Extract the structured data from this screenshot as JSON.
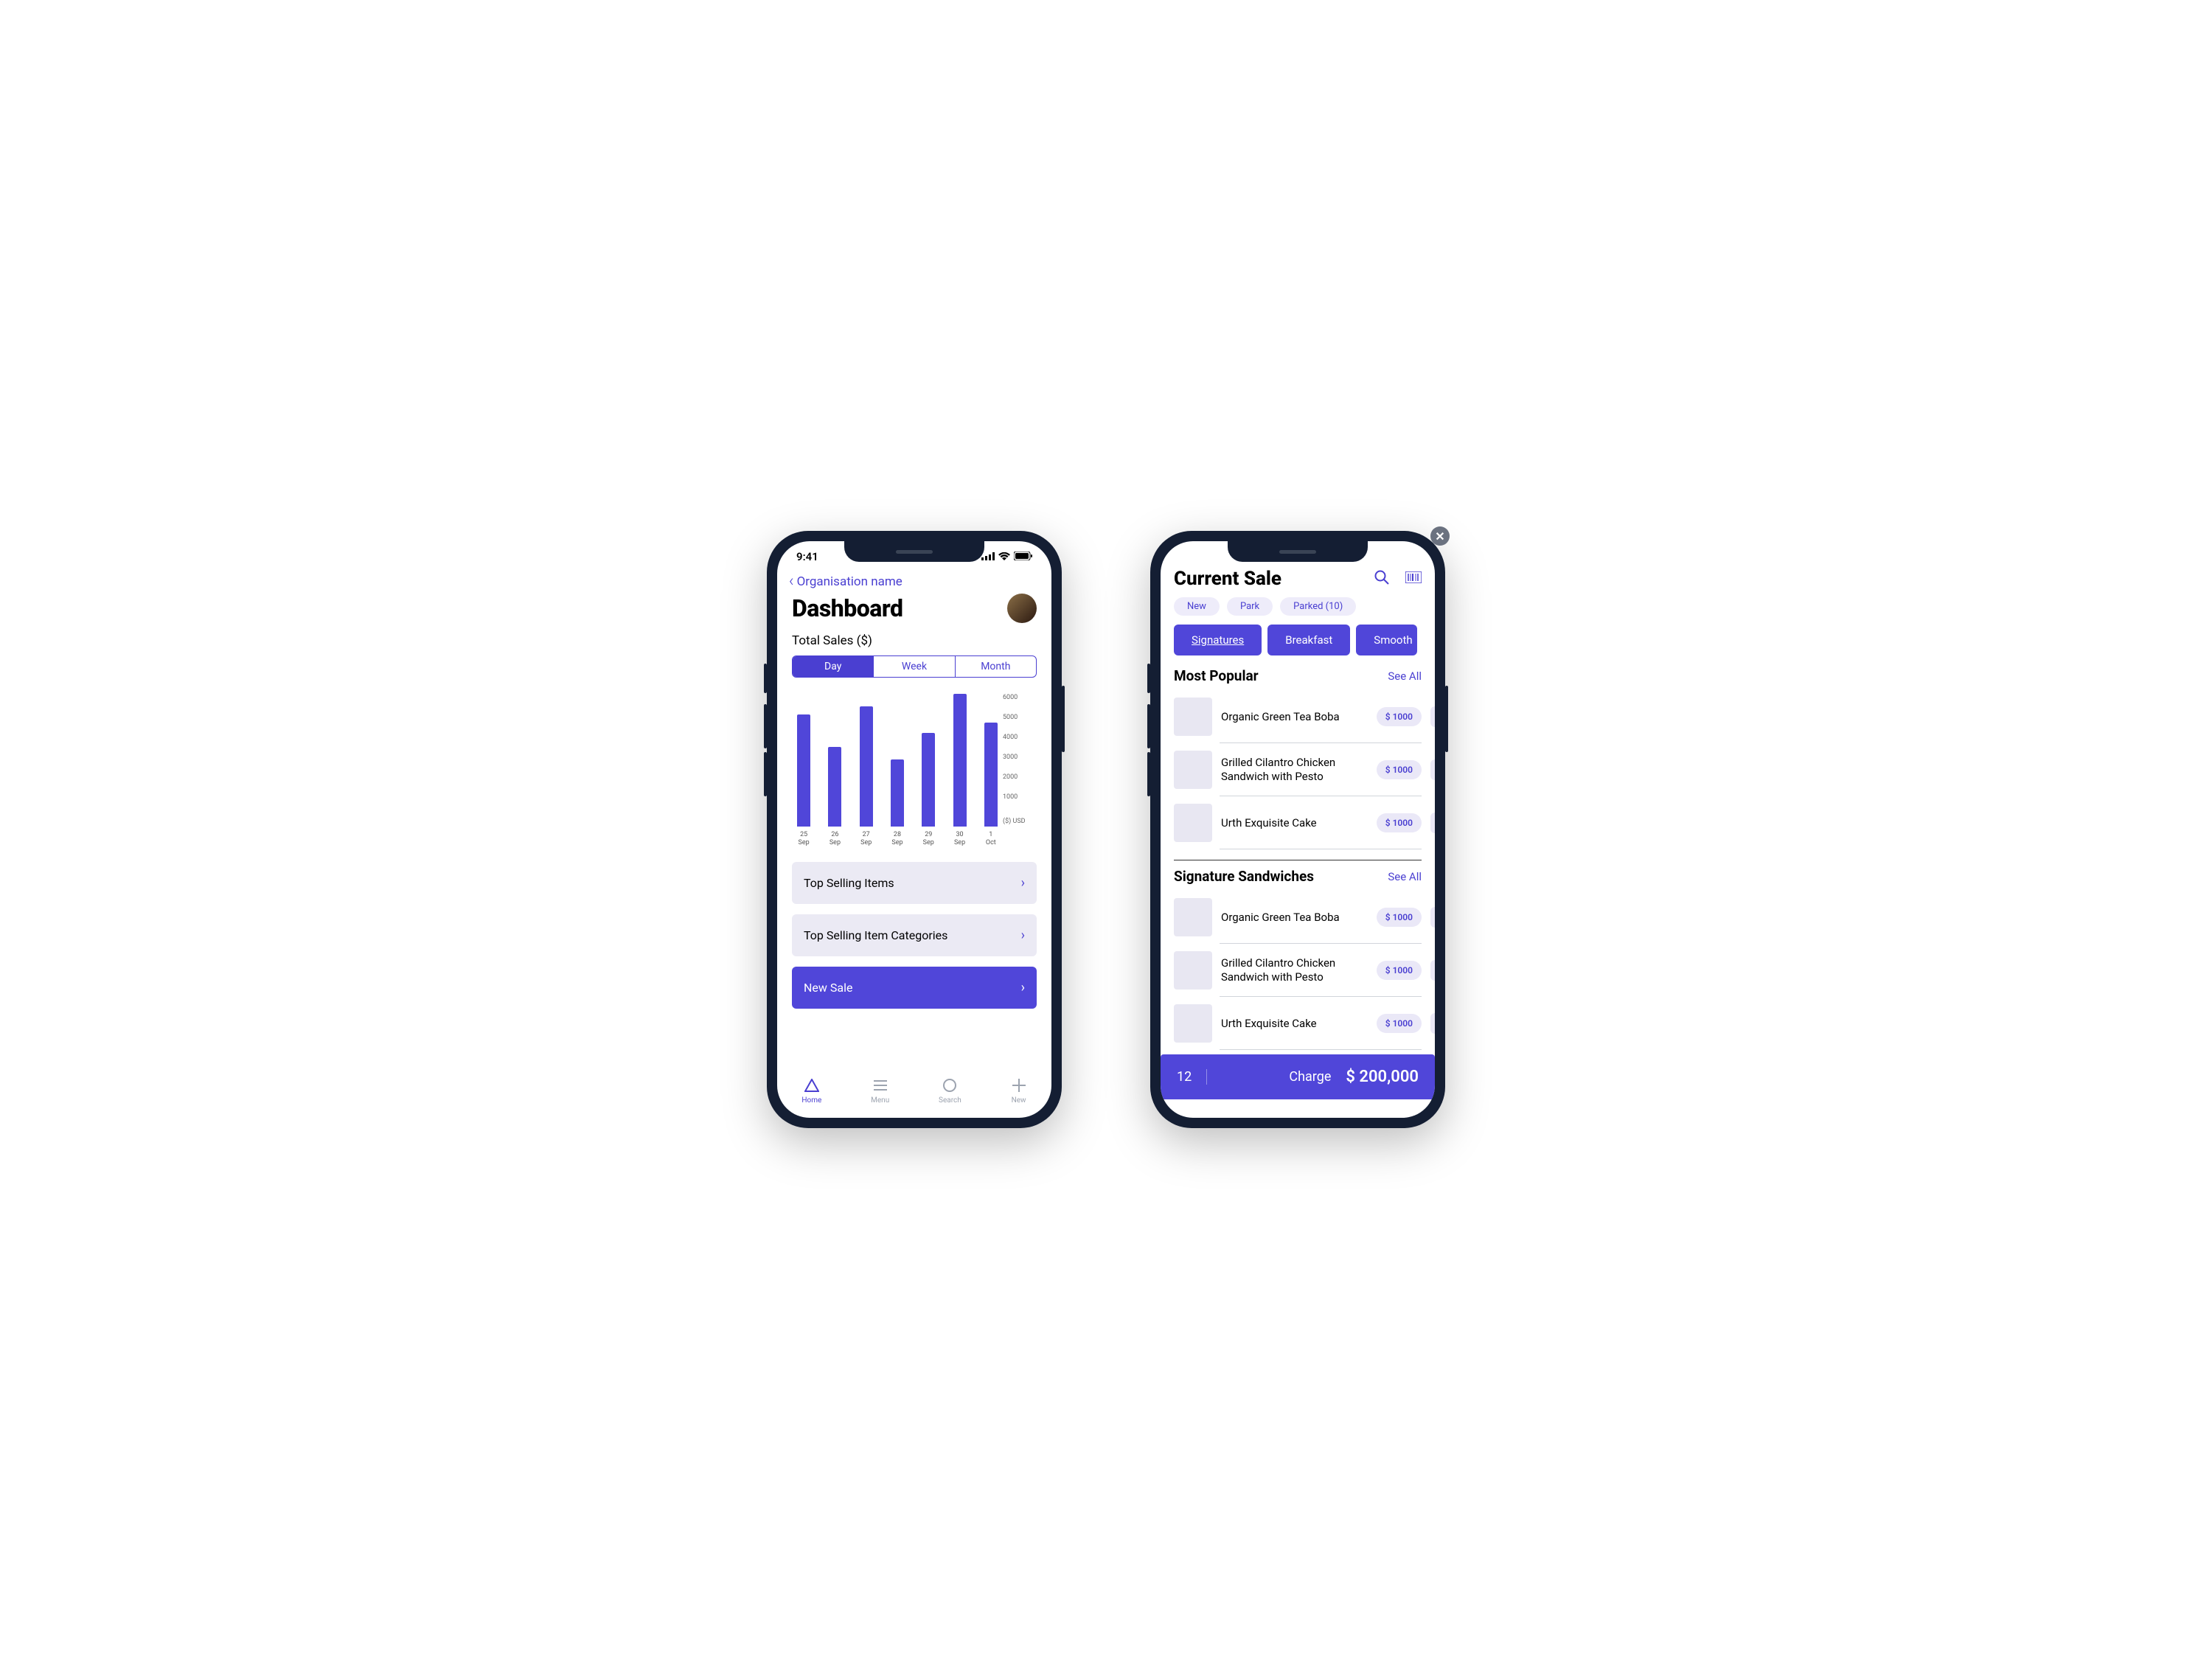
{
  "status": {
    "time": "9:41"
  },
  "phone1": {
    "back_label": "Organisation name",
    "title": "Dashboard",
    "subtitle": "Total Sales ($)",
    "segments": [
      "Day",
      "Week",
      "Month"
    ],
    "segment_active": 0,
    "cards": {
      "top_items": "Top Selling Items",
      "top_cats": "Top Selling Item Categories",
      "new_sale": "New Sale"
    },
    "tabs": [
      "Home",
      "Menu",
      "Search",
      "New"
    ]
  },
  "chart_data": {
    "type": "bar",
    "categories": [
      "25\nSep",
      "26\nSep",
      "27\nSep",
      "28\nSep",
      "29\nSep",
      "30\nSep",
      "1\nOct"
    ],
    "values": [
      5500,
      3900,
      5900,
      3300,
      4600,
      6500,
      5100
    ],
    "title": "Total Sales ($)",
    "xlabel": "",
    "ylabel": "($) USD",
    "ylim": [
      0,
      6500
    ],
    "yticks": [
      1000,
      2000,
      3000,
      4000,
      5000,
      6000
    ]
  },
  "phone2": {
    "title": "Current Sale",
    "chips": {
      "new": "New",
      "park": "Park",
      "parked": "Parked (10)"
    },
    "categories": [
      "Signatures",
      "Breakfast",
      "Smoothies"
    ],
    "category_active": 0,
    "sections": [
      {
        "title": "Most Popular",
        "see_all": "See All",
        "items": [
          {
            "name": "Organic Green Tea Boba",
            "price": "$ 1000"
          },
          {
            "name": "Grilled Cilantro Chicken Sandwich with Pesto",
            "price": "$ 1000"
          },
          {
            "name": "Urth Exquisite Cake",
            "price": "$ 1000"
          }
        ]
      },
      {
        "title": "Signature Sandwiches",
        "see_all": "See All",
        "items": [
          {
            "name": "Organic Green Tea Boba",
            "price": "$ 1000"
          },
          {
            "name": "Grilled Cilantro Chicken Sandwich with Pesto",
            "price": "$ 1000"
          },
          {
            "name": "Urth Exquisite Cake",
            "price": "$ 1000"
          }
        ]
      }
    ],
    "charge": {
      "count": "12",
      "label": "Charge",
      "amount": "$ 200,000"
    }
  }
}
